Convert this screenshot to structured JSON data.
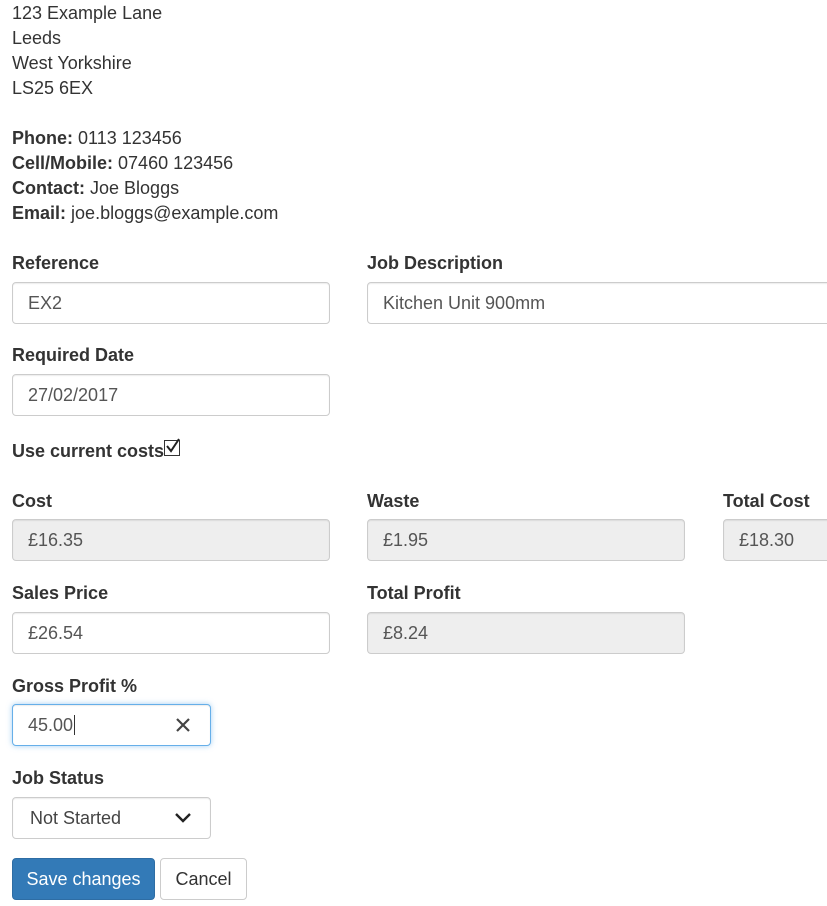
{
  "address": {
    "line1": "123 Example Lane",
    "line2": "Leeds",
    "line3": "West Yorkshire",
    "line4": "LS25 6EX"
  },
  "contact": {
    "phone_label": "Phone:",
    "phone": "0113 123456",
    "mobile_label": "Cell/Mobile:",
    "mobile": "07460 123456",
    "contact_label": "Contact:",
    "contact_name": "Joe Bloggs",
    "email_label": "Email:",
    "email": "joe.bloggs@example.com"
  },
  "form": {
    "reference": {
      "label": "Reference",
      "value": "EX2"
    },
    "job_description": {
      "label": "Job Description",
      "value": "Kitchen Unit 900mm"
    },
    "required_date": {
      "label": "Required Date",
      "value": "27/02/2017"
    },
    "use_current_costs": {
      "label": "Use current costs",
      "checked": true
    },
    "cost": {
      "label": "Cost",
      "value": "£16.35"
    },
    "waste": {
      "label": "Waste",
      "value": "£1.95"
    },
    "total_cost": {
      "label": "Total Cost",
      "value": "£18.30"
    },
    "sales_price": {
      "label": "Sales Price",
      "value": "£26.54"
    },
    "total_profit": {
      "label": "Total Profit",
      "value": "£8.24"
    },
    "gross_profit": {
      "label": "Gross Profit %",
      "value": "45.00"
    },
    "job_status": {
      "label": "Job Status",
      "value": "Not Started"
    }
  },
  "buttons": {
    "save": "Save changes",
    "cancel": "Cancel"
  },
  "colors": {
    "primary": "#337ab7",
    "readonly_bg": "#eeeeee",
    "focus_border": "#66afe9"
  },
  "icons": {
    "clear": "close-icon",
    "dropdown": "chevron-down-icon",
    "checkbox": "checkmark-icon"
  }
}
